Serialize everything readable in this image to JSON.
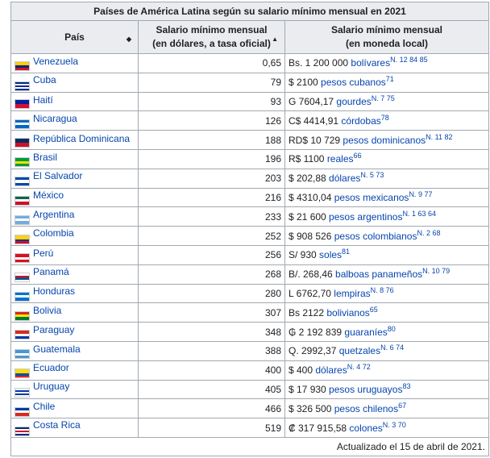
{
  "caption": "Países de América Latina según su salario mínimo mensual en 2021",
  "headers": {
    "country": "País",
    "usd_line1": "Salario mínimo mensual",
    "usd_line2": "(en dólares, a tasa oficial)",
    "local_line1": "Salario mínimo mensual",
    "local_line2": "(en moneda local)"
  },
  "rows": [
    {
      "country": "Venezuela",
      "flag": [
        "#FFCC00",
        "#00247D",
        "#CF142B"
      ],
      "usd": "0,65",
      "amount": "Bs. 1 200 000 ",
      "currency": "bolívares",
      "sup": "N. 12 84 85"
    },
    {
      "country": "Cuba",
      "flag": [
        "#002A8F",
        "#ffffff",
        "#002A8F",
        "#ffffff",
        "#002A8F"
      ],
      "usd": "79",
      "amount": "$ 2100 ",
      "currency": "pesos cubanos",
      "sup": "71"
    },
    {
      "country": "Haití",
      "flag": [
        "#00209F",
        "#D21034"
      ],
      "usd": "93",
      "amount": "G 7604,17 ",
      "currency": "gourdes",
      "sup": "N. 7 75"
    },
    {
      "country": "Nicaragua",
      "flag": [
        "#0067C6",
        "#ffffff",
        "#0067C6"
      ],
      "usd": "126",
      "amount": "C$ 4414,91 ",
      "currency": "córdobas",
      "sup": "78"
    },
    {
      "country": "República Dominicana",
      "flag": [
        "#002D62",
        "#CE1126"
      ],
      "usd": "188",
      "amount": "RD$ 10 729 ",
      "currency": "pesos dominicanos",
      "sup": "N. 11 82"
    },
    {
      "country": "Brasil",
      "flag": [
        "#009C3B",
        "#FFDF00",
        "#009C3B"
      ],
      "usd": "196",
      "amount": "R$ 1100 ",
      "currency": "reales",
      "sup": "66"
    },
    {
      "country": "El Salvador",
      "flag": [
        "#0047AB",
        "#ffffff",
        "#0047AB"
      ],
      "usd": "203",
      "amount": "$ 202,88 ",
      "currency": "dólares",
      "sup": "N. 5 73"
    },
    {
      "country": "México",
      "flag": [
        "#006847",
        "#ffffff",
        "#CE1126"
      ],
      "usd": "216",
      "amount": "$ 4310,04 ",
      "currency": "pesos mexicanos",
      "sup": "N. 9 77"
    },
    {
      "country": "Argentina",
      "flag": [
        "#74ACDF",
        "#ffffff",
        "#74ACDF"
      ],
      "usd": "233",
      "amount": "$ 21 600 ",
      "currency": "pesos argentinos",
      "sup": "N. 1 63 64"
    },
    {
      "country": "Colombia",
      "flag": [
        "#FCD116",
        "#FCD116",
        "#003893",
        "#CE1126"
      ],
      "usd": "252",
      "amount": "$ 908 526 ",
      "currency": "pesos colombianos",
      "sup": "N. 2 68"
    },
    {
      "country": "Perú",
      "flag": [
        "#D91023",
        "#ffffff",
        "#D91023"
      ],
      "usd": "256",
      "amount": "S/ 930 ",
      "currency": "soles",
      "sup": "81"
    },
    {
      "country": "Panamá",
      "flag": [
        "#ffffff",
        "#DA121A",
        "#005293",
        "#ffffff"
      ],
      "usd": "268",
      "amount": "B/. 268,46 ",
      "currency": "balboas panameños",
      "sup": "N. 10 79"
    },
    {
      "country": "Honduras",
      "flag": [
        "#0073CF",
        "#ffffff",
        "#0073CF"
      ],
      "usd": "280",
      "amount": "L 6762,70 ",
      "currency": "lempiras",
      "sup": "N. 8 76"
    },
    {
      "country": "Bolivia",
      "flag": [
        "#D52B1E",
        "#F9E300",
        "#007934"
      ],
      "usd": "307",
      "amount": "Bs 2122 ",
      "currency": "bolivianos",
      "sup": "65"
    },
    {
      "country": "Paraguay",
      "flag": [
        "#D52B1E",
        "#ffffff",
        "#0038A8"
      ],
      "usd": "348",
      "amount": "₲ 2 192 839 ",
      "currency": "guaraníes",
      "sup": "80"
    },
    {
      "country": "Guatemala",
      "flag": [
        "#4997D0",
        "#ffffff",
        "#4997D0"
      ],
      "usd": "388",
      "amount": "Q. 2992,37 ",
      "currency": "quetzales",
      "sup": "N. 6 74"
    },
    {
      "country": "Ecuador",
      "flag": [
        "#FFDD00",
        "#FFDD00",
        "#034EA2",
        "#ED1C24"
      ],
      "usd": "400",
      "amount": "$ 400 ",
      "currency": "dólares",
      "sup": "N. 4 72"
    },
    {
      "country": "Uruguay",
      "flag": [
        "#ffffff",
        "#0038A8",
        "#ffffff",
        "#0038A8",
        "#ffffff"
      ],
      "usd": "405",
      "amount": "$ 17 930 ",
      "currency": "pesos uruguayos",
      "sup": "83"
    },
    {
      "country": "Chile",
      "flag": [
        "#0039A6",
        "#ffffff",
        "#D52B1E"
      ],
      "usd": "466",
      "amount": "$ 326 500 ",
      "currency": "pesos chilenos",
      "sup": "67"
    },
    {
      "country": "Costa Rica",
      "flag": [
        "#002B7F",
        "#ffffff",
        "#CE1126",
        "#ffffff",
        "#002B7F"
      ],
      "usd": "519",
      "amount": "₡ 317 915,58 ",
      "currency": "colones",
      "sup": "N. 3 70"
    }
  ],
  "footer": "Actualizado el 15 de abril de 2021."
}
